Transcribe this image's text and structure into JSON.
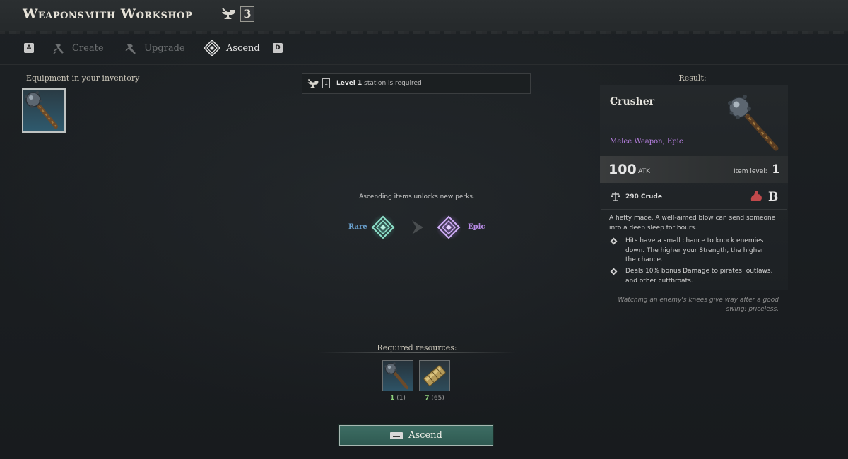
{
  "header": {
    "title": "Weaponsmith Workshop",
    "station_level": "3"
  },
  "tabs": {
    "prev_key": "A",
    "next_key": "D",
    "items": [
      {
        "label": "Create",
        "state": "inactive"
      },
      {
        "label": "Upgrade",
        "state": "inactive"
      },
      {
        "label": "Ascend",
        "state": "active"
      }
    ]
  },
  "inventory": {
    "label": "Equipment in your inventory"
  },
  "station_requirement": {
    "level_text": "Level 1",
    "suffix": "station is required",
    "badge": "1"
  },
  "ascend": {
    "info": "Ascending items unlocks new perks.",
    "from_tier": "Rare",
    "to_tier": "Epic",
    "from_color": "#6aa1cf",
    "to_color": "#b78be6"
  },
  "required_resources": {
    "label": "Required resources:",
    "items": [
      {
        "icon": "mace-icon",
        "need": "1",
        "have": "(1)"
      },
      {
        "icon": "ingot-bundle-icon",
        "need": "7",
        "have": "(65)"
      }
    ]
  },
  "ascend_button": {
    "label": "Ascend"
  },
  "result": {
    "label": "Result:",
    "name": "Crusher",
    "type": "Melee Weapon, Epic",
    "atk_value": "100",
    "atk_unit": "ATK",
    "item_level_label": "Item level:",
    "item_level": "1",
    "crude": "290 Crude",
    "strength_grade": "B",
    "description": "A hefty mace. A well-aimed blow can send someone into a deep sleep for hours.",
    "perks": [
      "Hits have a small chance to knock enemies down. The higher your Strength, the higher the chance.",
      "Deals 10% bonus Damage to pirates, outlaws, and other cutthroats."
    ],
    "quote": "Watching an enemy's knees give way after a good swing: priceless.",
    "type_color": "#b67fe0"
  }
}
